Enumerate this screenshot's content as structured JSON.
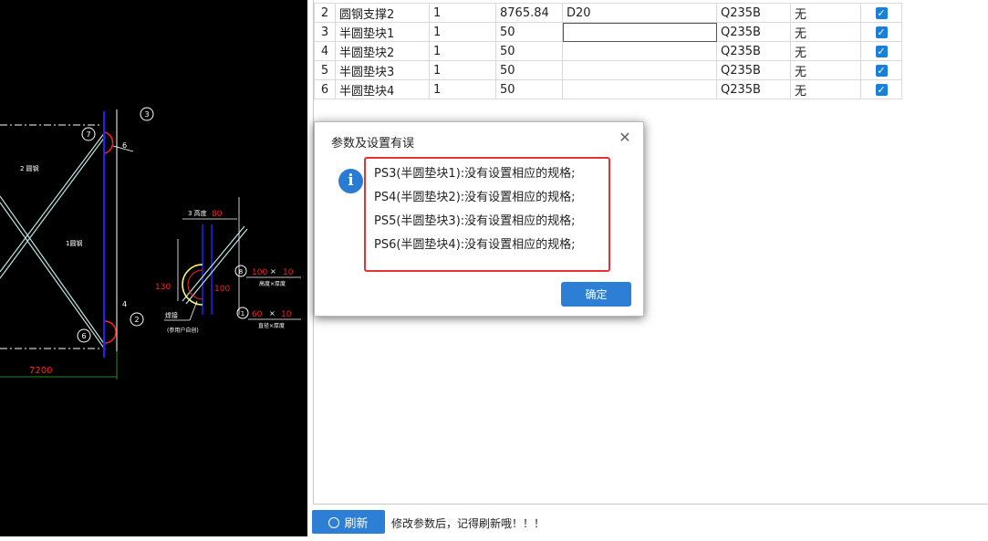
{
  "table": {
    "rows": [
      {
        "idx": "2",
        "name": "圆钢支撑2",
        "qty": "1",
        "length": "8765.84",
        "spec": "D20",
        "material": "Q235B",
        "extra": "无",
        "checked": true
      },
      {
        "idx": "3",
        "name": "半圆垫块1",
        "qty": "1",
        "length": "50",
        "spec": "",
        "material": "Q235B",
        "extra": "无",
        "checked": true
      },
      {
        "idx": "4",
        "name": "半圆垫块2",
        "qty": "1",
        "length": "50",
        "spec": "",
        "material": "Q235B",
        "extra": "无",
        "checked": true
      },
      {
        "idx": "5",
        "name": "半圆垫块3",
        "qty": "1",
        "length": "50",
        "spec": "",
        "material": "Q235B",
        "extra": "无",
        "checked": true
      },
      {
        "idx": "6",
        "name": "半圆垫块4",
        "qty": "1",
        "length": "50",
        "spec": "",
        "material": "Q235B",
        "extra": "无",
        "checked": true
      }
    ]
  },
  "dialog": {
    "title": "参数及设置有误",
    "close_glyph": "✕",
    "icon": "info-icon",
    "icon_glyph": "i",
    "messages": [
      "PS3(半圆垫块1):没有设置相应的规格;",
      "PS4(半圆垫块2):没有设置相应的规格;",
      "PS5(半圆垫块3):没有设置相应的规格;",
      "PS6(半圆垫块4):没有设置相应的规格;"
    ],
    "ok_label": "确定"
  },
  "bottom": {
    "refresh_label": "刷新",
    "hint": "修改参数后，记得刷新哦！！！"
  },
  "cad": {
    "labels": {
      "dim_7200": "7200",
      "rod2": "2 圆钢",
      "rod1": "1圆钢",
      "n3": "3",
      "n7": "7",
      "n6a": "6",
      "n4": "4",
      "n2": "2",
      "n6b": "6",
      "gap_label": "3 高度",
      "gap_val": "80",
      "v130": "130",
      "v100": "100",
      "n8": "8",
      "dim_a": "100",
      "dim_a2": "10",
      "dim_a_note": "高度×厚度",
      "n1": "1",
      "dim_b": "60",
      "dim_b2": "10",
      "dim_b_note": "直径×厚度",
      "weld": "焊接",
      "weld_note": "(参用户自创)"
    },
    "colors": {
      "line": "#bfe3e3",
      "accent": "#ff2020",
      "column": "#2020ff",
      "green": "#2a8a2a",
      "white": "#ffffff"
    }
  },
  "colors": {
    "accent": "#2d7fd6",
    "alert_border": "#e53333",
    "info": "#2a7bd3"
  }
}
